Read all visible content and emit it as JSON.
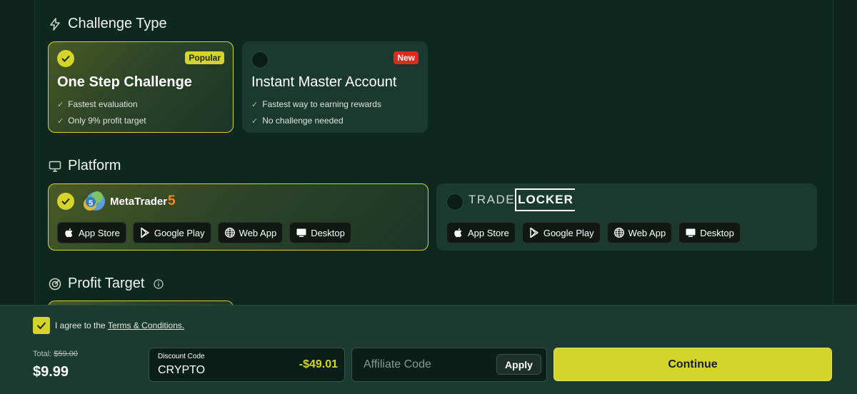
{
  "challenge_type": {
    "title": "Challenge Type",
    "cards": [
      {
        "name": "One Step Challenge",
        "badge": "Popular",
        "features": [
          "Fastest evaluation",
          "Only 9% profit target"
        ],
        "selected": true
      },
      {
        "name": "Instant Master Account",
        "badge": "New",
        "features": [
          "Fastest way to earning rewards",
          "No challenge needed"
        ],
        "selected": false
      }
    ]
  },
  "platform": {
    "title": "Platform",
    "options": [
      {
        "brand_main": "MetaTrader",
        "brand_number": "5",
        "selected": true,
        "stores": [
          "App Store",
          "Google Play",
          "Web App",
          "Desktop"
        ]
      },
      {
        "brand_main": "TRADE",
        "brand_box": "LOCKER",
        "selected": false,
        "stores": [
          "App Store",
          "Google Play",
          "Web App",
          "Desktop"
        ]
      }
    ]
  },
  "profit_target": {
    "title": "Profit Target",
    "info_icon": "info-icon"
  },
  "footer": {
    "agree_text": "I agree to the ",
    "terms_link": "Terms & Conditions.",
    "agreed": true,
    "total_label": "Total:",
    "original_price": "$59.00",
    "total_price": "$9.99",
    "discount_label": "Discount Code",
    "discount_code": "CRYPTO",
    "discount_amount": "-$49.01",
    "affiliate_placeholder": "Affiliate Code",
    "apply_label": "Apply",
    "continue_label": "Continue"
  },
  "colors": {
    "accent": "#d4d42a",
    "background": "#0c281f",
    "new_badge": "#e0281c"
  }
}
